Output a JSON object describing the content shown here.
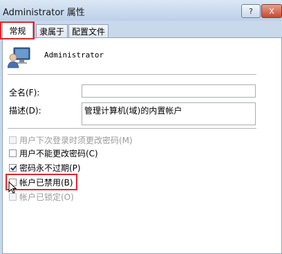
{
  "window": {
    "title": "Administrator 属性",
    "help_label": "?",
    "close_label": "X"
  },
  "tabs": [
    {
      "label": "常规"
    },
    {
      "label": "隶属于"
    },
    {
      "label": "配置文件"
    }
  ],
  "user": {
    "name": "Administrator"
  },
  "fields": {
    "fullname": {
      "label": "全名(F):",
      "value": ""
    },
    "description": {
      "label": "描述(D):",
      "value": "管理计算机(域)的内置帐户"
    }
  },
  "options": [
    {
      "label": "用户下次登录时须更改密码(M)",
      "checked": false,
      "enabled": false
    },
    {
      "label": "用户不能更改密码(C)",
      "checked": false,
      "enabled": true
    },
    {
      "label": "密码永不过期(P)",
      "checked": true,
      "enabled": true
    },
    {
      "label": "帐户已禁用(B)",
      "checked": false,
      "enabled": true
    },
    {
      "label": "帐户已锁定(O)",
      "checked": false,
      "enabled": false
    }
  ],
  "colors": {
    "highlight": "#e0262a",
    "background": "#c9d9ec"
  },
  "icons": {
    "user": "user-computer-icon",
    "cursor": "mouse-pointer-icon"
  }
}
